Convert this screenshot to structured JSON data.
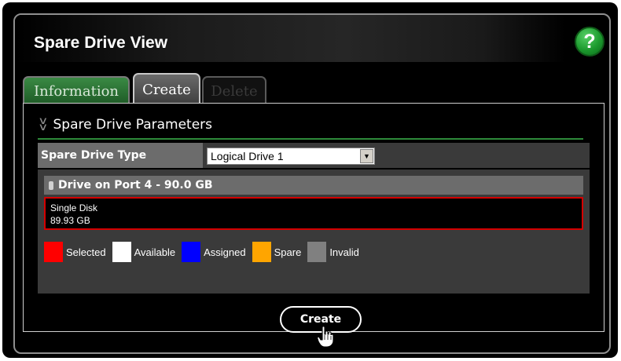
{
  "window": {
    "title": "Spare Drive View",
    "help_label": "?"
  },
  "tabs": [
    {
      "label": "Information",
      "state": "inactive"
    },
    {
      "label": "Create",
      "state": "active"
    },
    {
      "label": "Delete",
      "state": "disabled"
    }
  ],
  "section": {
    "title": "Spare Drive Parameters"
  },
  "spare_drive_type": {
    "label": "Spare Drive Type",
    "selected": "Logical Drive 1"
  },
  "drive": {
    "title": "Drive on Port 4 - 90.0 GB",
    "line1": "Single Disk",
    "line2": "89.93 GB"
  },
  "legend": [
    {
      "label": "Selected",
      "color": "#ff0000"
    },
    {
      "label": "Available",
      "color": "#ffffff"
    },
    {
      "label": "Assigned",
      "color": "#0000ff"
    },
    {
      "label": "Spare",
      "color": "#ffa500"
    },
    {
      "label": "Invalid",
      "color": "#808080"
    }
  ],
  "actions": {
    "create_label": "Create"
  },
  "colors": {
    "accent_green": "#2e8b3a",
    "selected_border": "#d40000"
  }
}
